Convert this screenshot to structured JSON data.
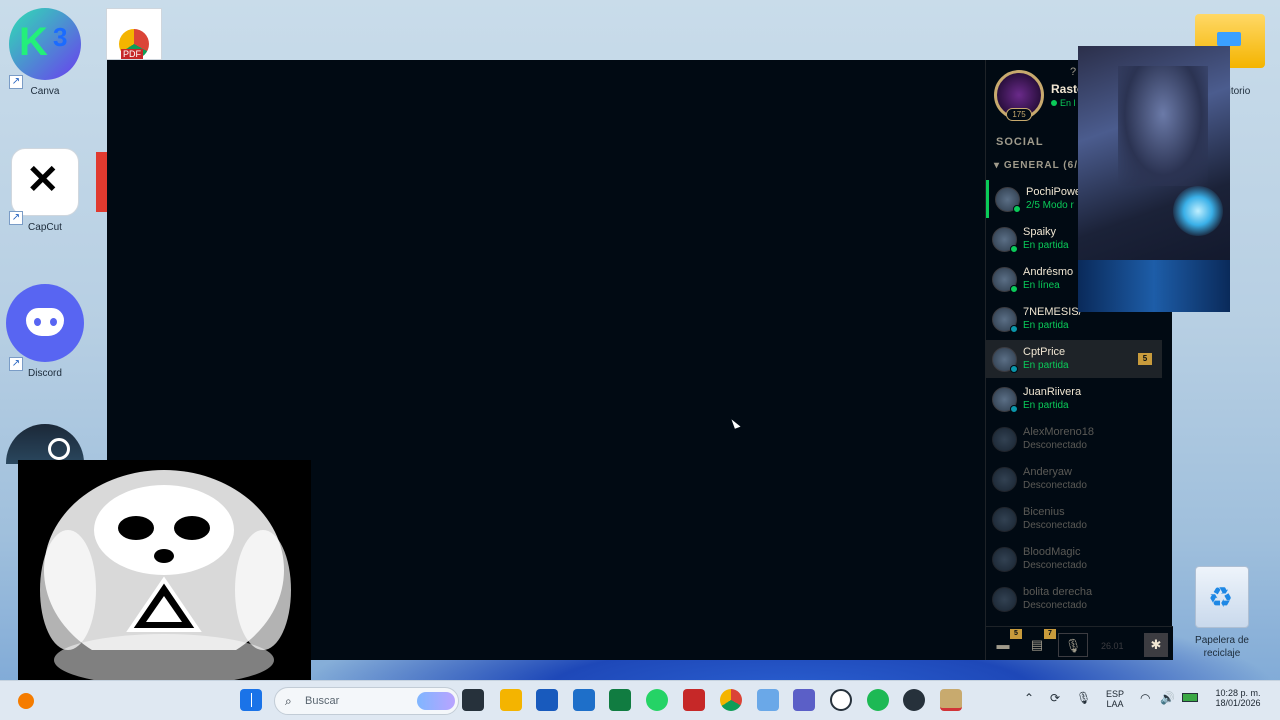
{
  "desktop": {
    "icons": [
      {
        "label": "Canva",
        "icon": "canva-icon"
      },
      {
        "label": "CapCut",
        "icon": "capcut-icon"
      },
      {
        "label": "Discord",
        "icon": "discord-icon"
      },
      {
        "label": "Steam",
        "icon": "steam-icon"
      },
      {
        "label": "escritorio",
        "icon": "folder-icon"
      },
      {
        "label": "Papelera de reciclaje",
        "icon": "recycle-bin-icon"
      }
    ],
    "pdf_label": "PDF"
  },
  "social": {
    "profile": {
      "name": "Raste",
      "status": "En l",
      "level": "175"
    },
    "help": "?",
    "title": "SOCIAL",
    "group": "GENERAL (6/",
    "friends": [
      {
        "name": "PochiPowe",
        "status": "2/5 Modo r",
        "status_color": "#0acb59",
        "dot": "#0acb59",
        "state": "lobby"
      },
      {
        "name": "Spaiky",
        "status": "En partida",
        "status_color": "#0acb59",
        "dot": "#0acb59",
        "state": "ingame"
      },
      {
        "name": "Andrésmo",
        "status": "En línea",
        "status_color": "#0acb59",
        "dot": "#0acb59",
        "state": "online"
      },
      {
        "name": "7NEMESIS/",
        "status": "En partida",
        "status_color": "#0acb59",
        "dot": "#0a96aa",
        "state": "ingame"
      },
      {
        "name": "CptPrice",
        "status": "En partida",
        "status_color": "#0acb59",
        "dot": "#0a96aa",
        "state": "ingame",
        "badge": "5"
      },
      {
        "name": "JuanRiivera",
        "status": "En partida",
        "status_color": "#0acb59",
        "dot": "#0a96aa",
        "state": "ingame"
      },
      {
        "name": "AlexMoreno18",
        "status": "Desconectado",
        "status_color": "#5b5a56",
        "dot": "",
        "state": "offline"
      },
      {
        "name": "Anderyaw",
        "status": "Desconectado",
        "status_color": "#5b5a56",
        "dot": "",
        "state": "offline"
      },
      {
        "name": "Bicenius",
        "status": "Desconectado",
        "status_color": "#5b5a56",
        "dot": "",
        "state": "offline"
      },
      {
        "name": "BloodMagic",
        "status": "Desconectado",
        "status_color": "#5b5a56",
        "dot": "",
        "state": "offline"
      },
      {
        "name": "bolita derecha",
        "status": "Desconectado",
        "status_color": "#5b5a56",
        "dot": "",
        "state": "offline"
      }
    ],
    "footer": {
      "chat_badge": "5",
      "mail_badge": "7",
      "version": "26.01"
    }
  },
  "taskbar": {
    "search_placeholder": "Buscar",
    "lang": "ESP",
    "lang_sub": "LAA",
    "time": "10:28 p. m.",
    "date": "18/01/2026"
  },
  "colors": {
    "client_bg": "#010a13",
    "gold": "#c8aa6e",
    "online_green": "#0acb59"
  }
}
